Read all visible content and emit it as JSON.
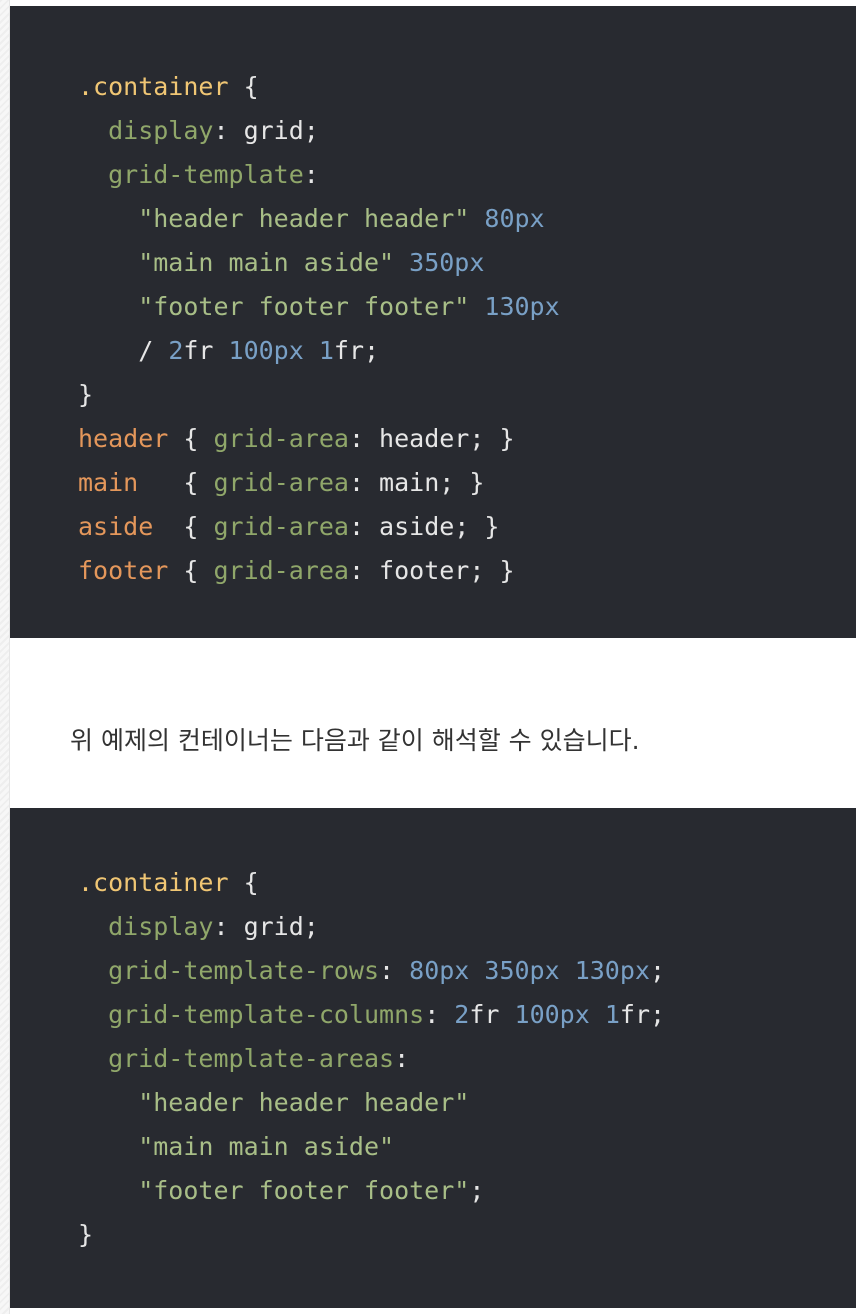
{
  "code_block_1": {
    "lines": [
      [
        {
          "t": ".container",
          "c": "sel"
        },
        {
          "t": " {",
          "c": "punct"
        }
      ],
      [
        {
          "t": "  display",
          "c": "prop"
        },
        {
          "t": ": grid;",
          "c": "punct"
        }
      ],
      [
        {
          "t": "  grid-template",
          "c": "prop"
        },
        {
          "t": ":",
          "c": "punct"
        }
      ],
      [
        {
          "t": "    \"header header header\"",
          "c": "str"
        },
        {
          "t": " ",
          "c": "punct"
        },
        {
          "t": "80px",
          "c": "num"
        }
      ],
      [
        {
          "t": "    \"main main aside\"",
          "c": "str"
        },
        {
          "t": " ",
          "c": "punct"
        },
        {
          "t": "350px",
          "c": "num"
        }
      ],
      [
        {
          "t": "    \"footer footer footer\"",
          "c": "str"
        },
        {
          "t": " ",
          "c": "punct"
        },
        {
          "t": "130px",
          "c": "num"
        }
      ],
      [
        {
          "t": "    / ",
          "c": "punct"
        },
        {
          "t": "2",
          "c": "num"
        },
        {
          "t": "fr ",
          "c": "punct"
        },
        {
          "t": "100px",
          "c": "num"
        },
        {
          "t": " ",
          "c": "punct"
        },
        {
          "t": "1",
          "c": "num"
        },
        {
          "t": "fr;",
          "c": "punct"
        }
      ],
      [
        {
          "t": "}",
          "c": "punct"
        }
      ],
      [
        {
          "t": "header",
          "c": "tag"
        },
        {
          "t": " { ",
          "c": "punct"
        },
        {
          "t": "grid-area",
          "c": "prop"
        },
        {
          "t": ": header; }",
          "c": "punct"
        }
      ],
      [
        {
          "t": "main",
          "c": "tag"
        },
        {
          "t": "   { ",
          "c": "punct"
        },
        {
          "t": "grid-area",
          "c": "prop"
        },
        {
          "t": ": main; }",
          "c": "punct"
        }
      ],
      [
        {
          "t": "aside",
          "c": "tag"
        },
        {
          "t": "  { ",
          "c": "punct"
        },
        {
          "t": "grid-area",
          "c": "prop"
        },
        {
          "t": ": aside; }",
          "c": "punct"
        }
      ],
      [
        {
          "t": "footer",
          "c": "tag"
        },
        {
          "t": " { ",
          "c": "punct"
        },
        {
          "t": "grid-area",
          "c": "prop"
        },
        {
          "t": ": footer; }",
          "c": "punct"
        }
      ]
    ]
  },
  "paragraph": "위 예제의 컨테이너는 다음과 같이 해석할 수 있습니다.",
  "code_block_2": {
    "lines": [
      [
        {
          "t": ".container",
          "c": "sel"
        },
        {
          "t": " {",
          "c": "punct"
        }
      ],
      [
        {
          "t": "  display",
          "c": "prop"
        },
        {
          "t": ": grid;",
          "c": "punct"
        }
      ],
      [
        {
          "t": "  grid-template-rows",
          "c": "prop"
        },
        {
          "t": ": ",
          "c": "punct"
        },
        {
          "t": "80px 350px 130px",
          "c": "num"
        },
        {
          "t": ";",
          "c": "punct"
        }
      ],
      [
        {
          "t": "  grid-template-columns",
          "c": "prop"
        },
        {
          "t": ": ",
          "c": "punct"
        },
        {
          "t": "2",
          "c": "num"
        },
        {
          "t": "fr ",
          "c": "punct"
        },
        {
          "t": "100px",
          "c": "num"
        },
        {
          "t": " ",
          "c": "punct"
        },
        {
          "t": "1",
          "c": "num"
        },
        {
          "t": "fr;",
          "c": "punct"
        }
      ],
      [
        {
          "t": "  grid-template-areas",
          "c": "prop"
        },
        {
          "t": ":",
          "c": "punct"
        }
      ],
      [
        {
          "t": "    \"header header header\"",
          "c": "str"
        }
      ],
      [
        {
          "t": "    \"main main aside\"",
          "c": "str"
        }
      ],
      [
        {
          "t": "    \"footer footer footer\"",
          "c": "str"
        },
        {
          "t": ";",
          "c": "punct"
        }
      ],
      [
        {
          "t": "}",
          "c": "punct"
        }
      ]
    ]
  },
  "colors": {
    "code_background": "#282a30",
    "selector": "#f0c674",
    "element_selector": "#e4975b",
    "property": "#90a76a",
    "string": "#a8be87",
    "number": "#79a0c6",
    "text": "#e6e6e6"
  }
}
